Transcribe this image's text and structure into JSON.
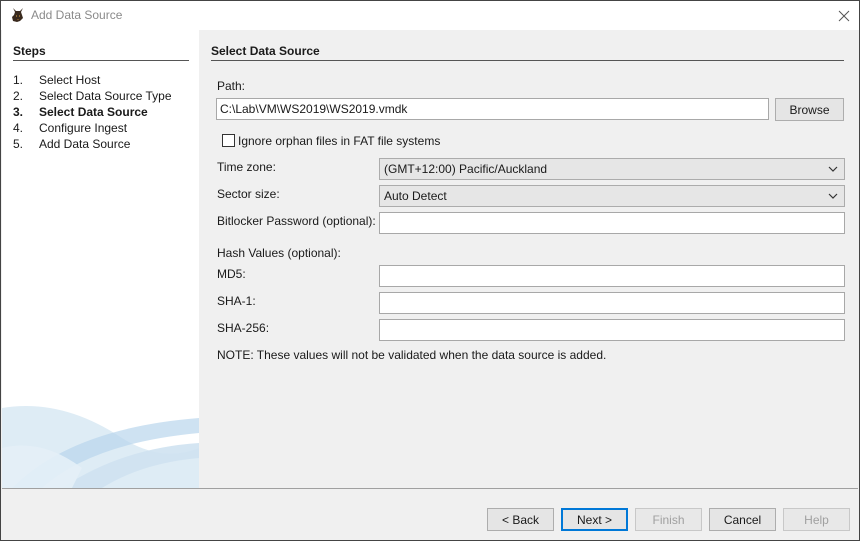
{
  "window": {
    "title": "Add Data Source"
  },
  "steps": {
    "title": "Steps",
    "items": [
      {
        "num": "1.",
        "label": "Select Host"
      },
      {
        "num": "2.",
        "label": "Select Data Source Type"
      },
      {
        "num": "3.",
        "label": "Select Data Source",
        "current": true
      },
      {
        "num": "4.",
        "label": "Configure Ingest"
      },
      {
        "num": "5.",
        "label": "Add Data Source"
      }
    ]
  },
  "main": {
    "section_title": "Select Data Source",
    "path_label": "Path:",
    "path_value": "C:\\Lab\\VM\\WS2019\\WS2019.vmdk",
    "browse_label": "Browse",
    "ignore_orphan_label": "Ignore orphan files in FAT file systems",
    "ignore_orphan_checked": false,
    "timezone_label": "Time zone:",
    "timezone_value": "(GMT+12:00) Pacific/Auckland",
    "sector_label": "Sector size:",
    "sector_value": "Auto Detect",
    "bitlocker_label": "Bitlocker Password (optional):",
    "bitlocker_value": "",
    "hash_title": "Hash Values (optional):",
    "md5_label": "MD5:",
    "md5_value": "",
    "sha1_label": "SHA-1:",
    "sha1_value": "",
    "sha256_label": "SHA-256:",
    "sha256_value": "",
    "note": "NOTE: These values will not be validated when the data source is added."
  },
  "footer": {
    "back_label": "< Back",
    "next_label": "Next >",
    "finish_label": "Finish",
    "cancel_label": "Cancel",
    "help_label": "Help"
  },
  "icons": {
    "app": "autopsy-dog-icon",
    "close": "close-icon",
    "dropdown": "chevron-down-icon"
  }
}
